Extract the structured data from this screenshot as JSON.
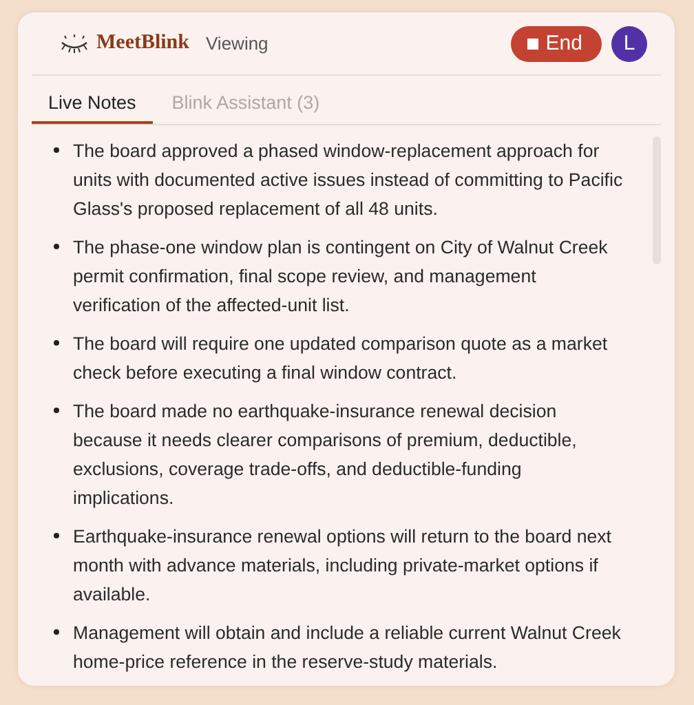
{
  "header": {
    "brand": "MeetBlink",
    "status": "Viewing",
    "end_button": "End",
    "avatar": "L"
  },
  "tabs": [
    {
      "label": "Live Notes",
      "selected": true
    },
    {
      "label": "Blink Assistant (3)",
      "selected": false
    }
  ],
  "notes": [
    "The board approved a phased window-replacement approach for units with documented active issues instead of committing to Pacific Glass's proposed replacement of all 48 units.",
    "The phase-one window plan is contingent on City of Walnut Creek permit confirmation, final scope review, and management verification of the affected-unit list.",
    "The board will require one updated comparison quote as a market check before executing a final window contract.",
    "The board made no earthquake-insurance renewal decision because it needs clearer comparisons of premium, deductible, exclusions, coverage trade-offs, and deductible-funding implications.",
    "Earthquake-insurance renewal options will return to the board next month with advance materials, including private-market options if available.",
    "Management will obtain and include a reliable current Walnut Creek home-price reference in the reserve-study materials."
  ]
}
